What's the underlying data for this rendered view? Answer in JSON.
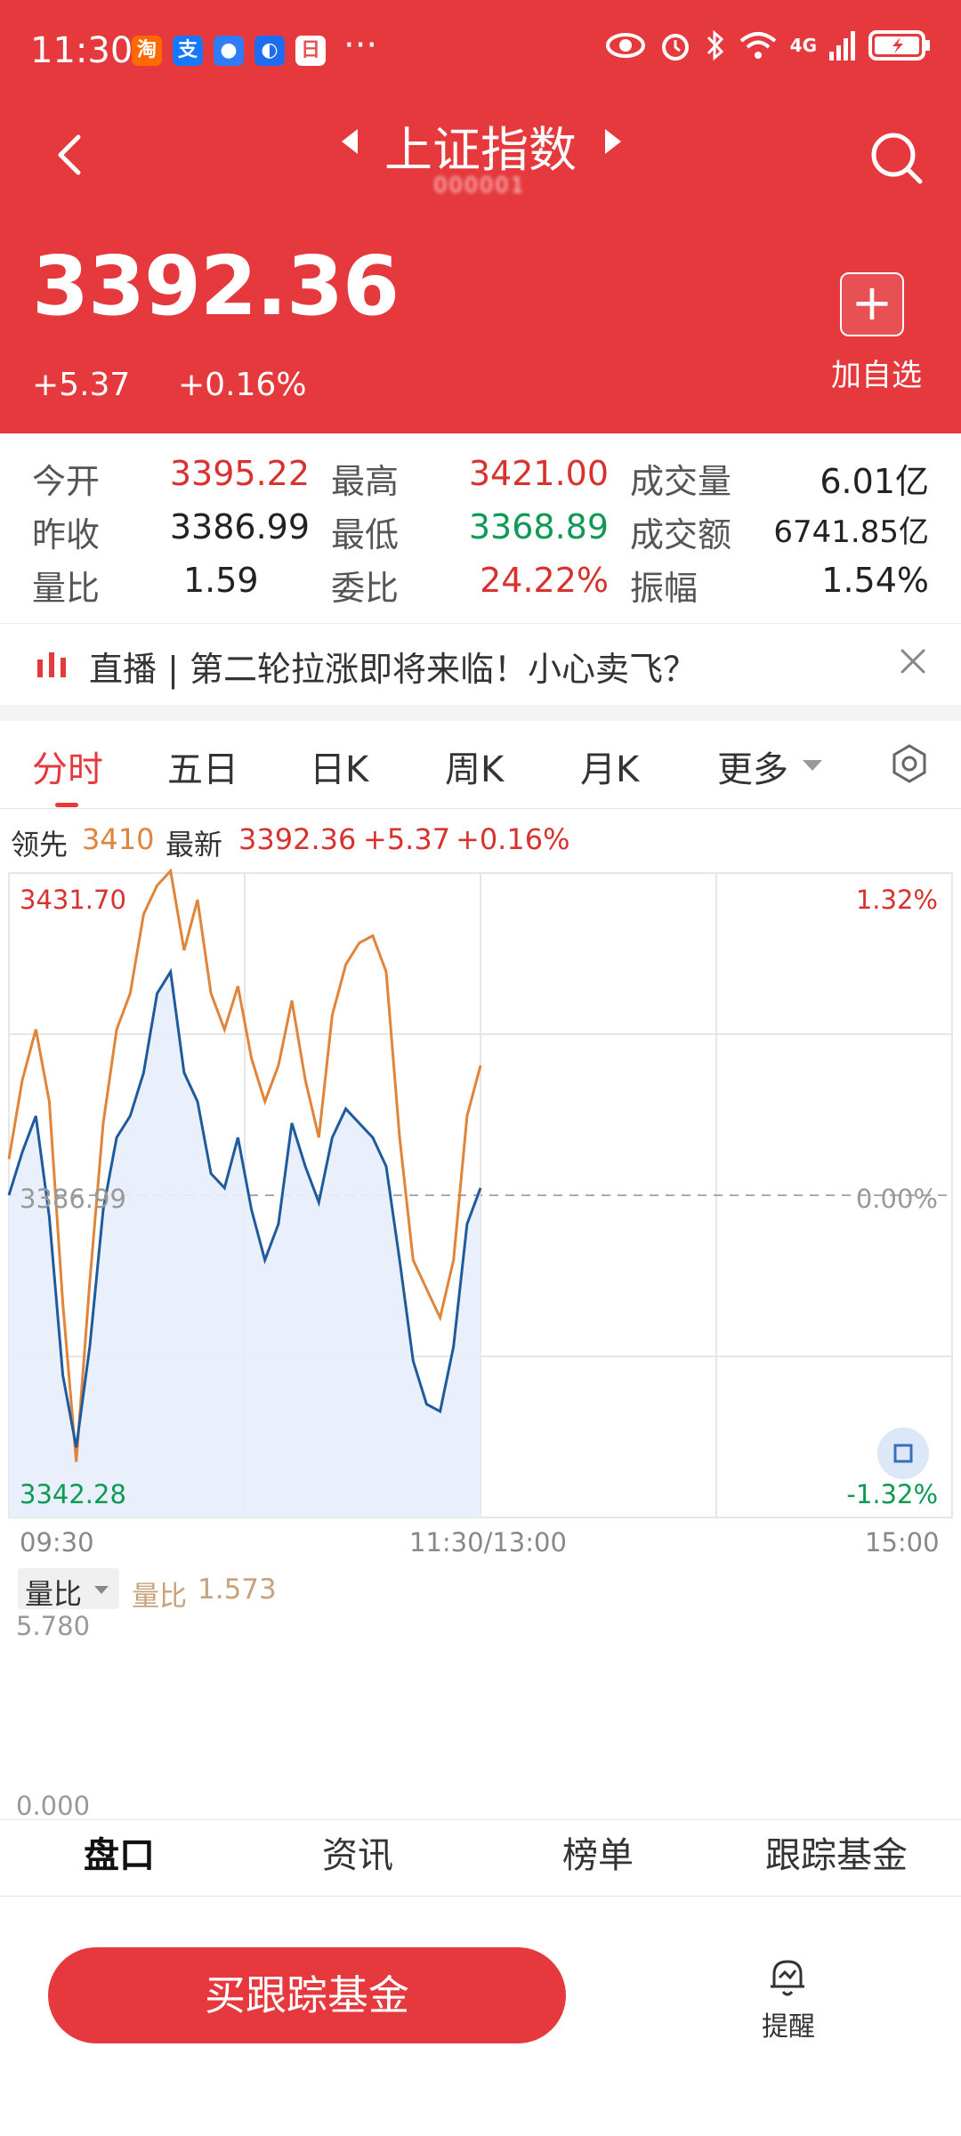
{
  "status_bar": {
    "time": "11:30",
    "apps": [
      {
        "icon": "taobao-icon",
        "glyph": "淘",
        "color": "#ff6a00"
      },
      {
        "icon": "alipay-icon",
        "glyph": "支",
        "color": "#1677ff"
      },
      {
        "icon": "message-icon",
        "glyph": "●",
        "color": "#2f7cf6"
      },
      {
        "icon": "tips-icon",
        "glyph": "◐",
        "color": "#1e6cf0"
      },
      {
        "icon": "calendar-icon",
        "glyph": "日",
        "color": "#e85050"
      }
    ],
    "more": "···",
    "network": "4G"
  },
  "header": {
    "title": "上证指数",
    "code": "000001",
    "price": "3392.36",
    "change": "+5.37",
    "change_pct": "+0.16%",
    "add_label": "加自选"
  },
  "stats": [
    {
      "label": "今开",
      "value": "3395.22",
      "color": "red"
    },
    {
      "label": "最高",
      "value": "3421.00",
      "color": "red"
    },
    {
      "label": "成交量",
      "value": "6.01亿",
      "color": "dark"
    },
    {
      "label": "昨收",
      "value": "3386.99",
      "color": "dark"
    },
    {
      "label": "最低",
      "value": "3368.89",
      "color": "green"
    },
    {
      "label": "成交额",
      "value": "6741.85亿",
      "color": "dark"
    },
    {
      "label": "量比",
      "value": "1.59",
      "color": "dark"
    },
    {
      "label": "委比",
      "value": "24.22%",
      "color": "red"
    },
    {
      "label": "振幅",
      "value": "1.54%",
      "color": "dark"
    }
  ],
  "banner": {
    "text": "直播 | 第二轮拉涨即将来临！小心卖飞？"
  },
  "tabs": [
    "分时",
    "五日",
    "日K",
    "周K",
    "月K",
    "更多"
  ],
  "legend": {
    "lead_label": "领先",
    "lead_value": "3410",
    "latest_label": "最新",
    "latest_value": "3392.36",
    "change": "+5.37",
    "change_pct": "+0.16%"
  },
  "chart_data": {
    "type": "line",
    "y_max_label": "3431.70",
    "y_mid_label": "3386.99",
    "y_min_label": "3342.28",
    "pct_max_label": "1.32%",
    "pct_mid_label": "0.00%",
    "pct_min_label": "-1.32%",
    "ylim": [
      3342.28,
      3431.7
    ],
    "x_ticks": [
      "09:30",
      "11:30/13:00",
      "15:00"
    ],
    "series": [
      {
        "name": "领先",
        "color": "#e0843a",
        "values": [
          3392,
          3403,
          3410,
          3400,
          3372,
          3350,
          3375,
          3397,
          3410,
          3415,
          3426,
          3430,
          3432,
          3421,
          3428,
          3415,
          3410,
          3416,
          3406,
          3400,
          3405,
          3414,
          3403,
          3395,
          3412,
          3419,
          3422,
          3423,
          3418,
          3395,
          3378,
          3374,
          3370,
          3378,
          3398,
          3405
        ]
      },
      {
        "name": "最新",
        "color": "#1f5a9c",
        "values": [
          3387,
          3393,
          3398,
          3384,
          3362,
          3352,
          3366,
          3385,
          3395,
          3398,
          3404,
          3415,
          3418,
          3404,
          3400,
          3390,
          3388,
          3395,
          3385,
          3378,
          3383,
          3397,
          3391,
          3386,
          3395,
          3399,
          3397,
          3395,
          3391,
          3378,
          3364,
          3358,
          3357,
          3366,
          3383,
          3388
        ]
      }
    ]
  },
  "volume": {
    "selector": "量比",
    "label": "量比",
    "value": "1.573",
    "max_label": "5.780",
    "min_label": "0.000",
    "color": "#c7a27a"
  },
  "bottom_tabs": [
    "盘口",
    "资讯",
    "榜单",
    "跟踪基金"
  ],
  "bottom_bar": {
    "buy_label": "买跟踪基金",
    "alert_label": "提醒"
  }
}
